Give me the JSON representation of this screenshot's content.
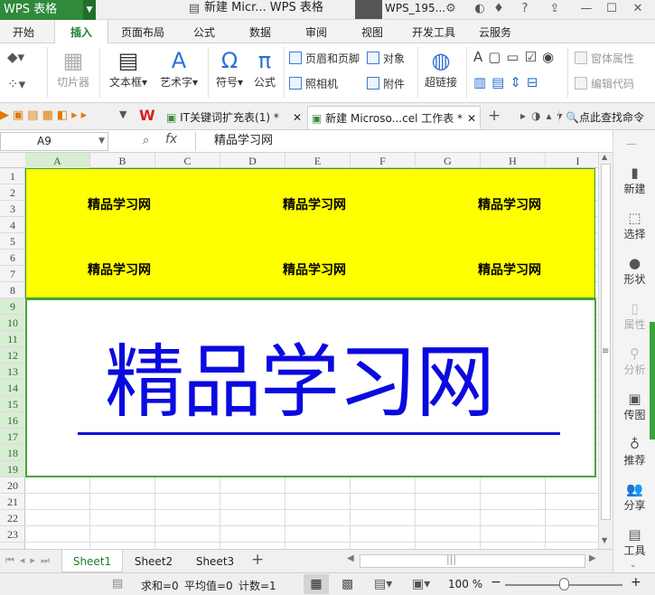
{
  "titlebar": {
    "app_name": "WPS 表格",
    "doc_title": "新建 Micr... WPS 表格",
    "user": "WPS_195...",
    "help": "?"
  },
  "menu": {
    "tabs": [
      "开始",
      "插入",
      "页面布局",
      "公式",
      "数据",
      "审阅",
      "视图",
      "开发工具",
      "云服务"
    ],
    "active": "插入"
  },
  "ribbon": {
    "slicer": "切片器",
    "textbox": "文本框",
    "wordart": "艺术字",
    "symbol": "符号",
    "formula": "公式",
    "header_footer": "页眉和页脚",
    "object": "对象",
    "camera": "照相机",
    "attachment": "附件",
    "hyperlink": "超链接",
    "form_properties": "窗体属性",
    "edit_code": "编辑代码"
  },
  "doc_tabs": {
    "tab1": "IT关键词扩充表(1) *",
    "tab2": "新建 Microso...cel 工作表 *",
    "search": "点此查找命令"
  },
  "formula_bar": {
    "name_box": "A9",
    "fx": "fx",
    "content": "精品学习网"
  },
  "grid": {
    "columns": [
      "A",
      "B",
      "C",
      "D",
      "E",
      "F",
      "G",
      "H",
      "I"
    ],
    "rows": [
      "1",
      "2",
      "3",
      "4",
      "5",
      "6",
      "7",
      "8",
      "9",
      "10",
      "11",
      "12",
      "13",
      "14",
      "15",
      "16",
      "17",
      "18",
      "19",
      "20",
      "21",
      "22",
      "23"
    ],
    "yellow_label": "精品学习网",
    "big_text": "精品学习网",
    "yellow_color": "#ffff00",
    "big_text_color": "#0a0ae0"
  },
  "right_panel": {
    "items": [
      "新建",
      "选择",
      "形状",
      "属性",
      "分析",
      "传图",
      "推荐",
      "分享",
      "工具"
    ]
  },
  "sheets": {
    "tabs": [
      "Sheet1",
      "Sheet2",
      "Sheet3"
    ],
    "add": "+"
  },
  "status": {
    "sum": "求和=0",
    "avg": "平均值=0",
    "count": "计数=1",
    "zoom": "100 %",
    "zoom_minus": "−",
    "zoom_plus": "+"
  }
}
